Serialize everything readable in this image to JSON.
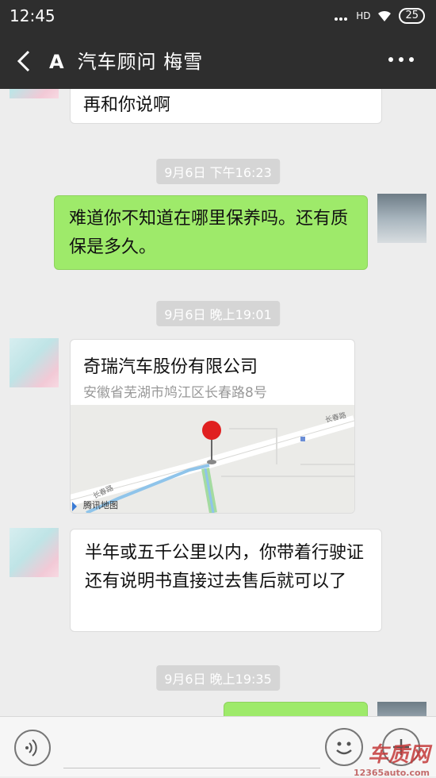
{
  "status_bar": {
    "time": "12:45",
    "network": "HD",
    "battery": "25"
  },
  "header": {
    "back_label": "A",
    "title": "汽车顾问 梅雪"
  },
  "messages": {
    "m0": "再和你说啊",
    "ts1": "9月6日 下午16:23",
    "m1": "难道你不知道在哪里保养吗。还有质保是多久。",
    "ts2": "9月6日 晚上19:01",
    "location": {
      "name": "奇瑞汽车股份有限公司",
      "address": "安徽省芜湖市鸠江区长春路8号",
      "road_label": "长春路",
      "road_label2": "长春路",
      "map_brand": "腾讯地图"
    },
    "m3": "半年或五千公里以内，你带着行驶证还有说明书直接过去售后就可以了",
    "ts3": "9月6日 晚上19:35"
  },
  "input": {
    "placeholder": ""
  },
  "watermark": {
    "brand": "车质网",
    "url": "12365auto.com"
  },
  "colors": {
    "bar": "#2e2e2e",
    "chat_bg": "#ededed",
    "sent_bubble": "#9eea6a",
    "received_bubble": "#ffffff",
    "pin": "#e02020"
  },
  "icons": [
    "back-arrow-icon",
    "more-icon",
    "map-pin-icon",
    "voice-icon",
    "emoji-icon",
    "plus-icon",
    "wifi-icon",
    "signal-icon",
    "battery-icon"
  ]
}
